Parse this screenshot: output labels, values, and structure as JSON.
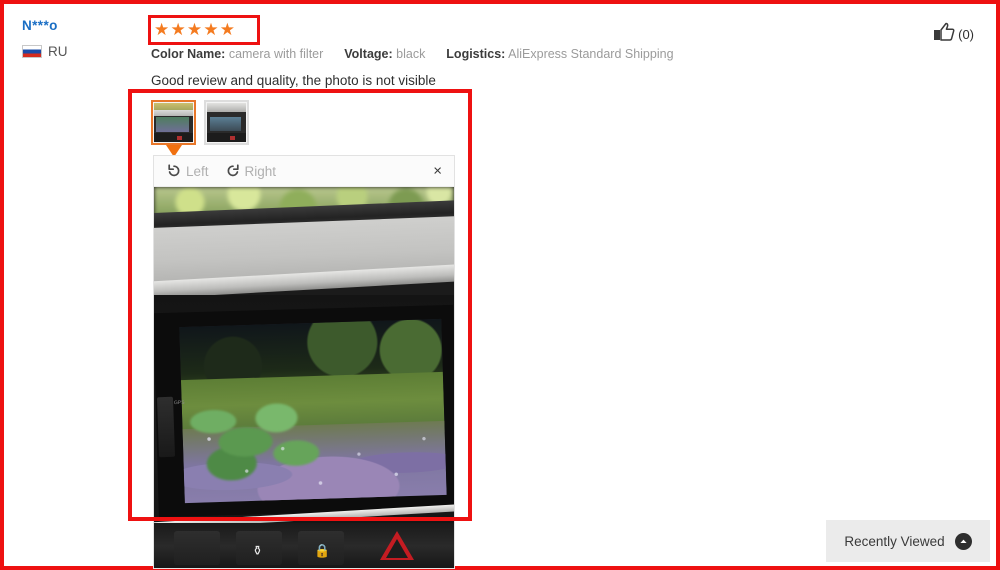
{
  "review": {
    "reviewer_name": "N***o",
    "country_code": "RU",
    "country_flag_icon": "russia-flag-icon",
    "rating_stars": "★★★★★",
    "rating_value": 5,
    "rating_max": 5,
    "attributes": [
      {
        "label": "Color Name:",
        "value": "camera with filter"
      },
      {
        "label": "Voltage:",
        "value": "black"
      },
      {
        "label": "Logistics:",
        "value": "AliExpress Standard Shipping"
      }
    ],
    "body_text": "Good review and quality, the photo is not visible",
    "helpful": {
      "icon": "thumbs-up-icon",
      "count_label": "(0)",
      "count": 0
    }
  },
  "media": {
    "thumbnails": [
      {
        "name": "thumbnail-1",
        "selected": true
      },
      {
        "name": "thumbnail-2",
        "selected": false
      }
    ],
    "viewer": {
      "rotate_left_label": "Left",
      "rotate_left_icon": "rotate-left-icon",
      "rotate_right_label": "Right",
      "rotate_right_icon": "rotate-right-icon",
      "close_icon": "close-icon",
      "close_label": "×",
      "photo_description": "Car dashboard with rear-view camera screen showing grass and gravel"
    }
  },
  "recently_viewed": {
    "label": "Recently Viewed",
    "toggle_icon": "chevron-up-icon"
  },
  "colors": {
    "annotation_red": "#ee1111",
    "star_orange": "#f47b20",
    "selected_thumb_orange": "#e8772a",
    "reviewer_link_blue": "#1a6ec4",
    "attribute_value_gray": "#9b9b9b",
    "recently_viewed_bg": "#ebebeb"
  }
}
